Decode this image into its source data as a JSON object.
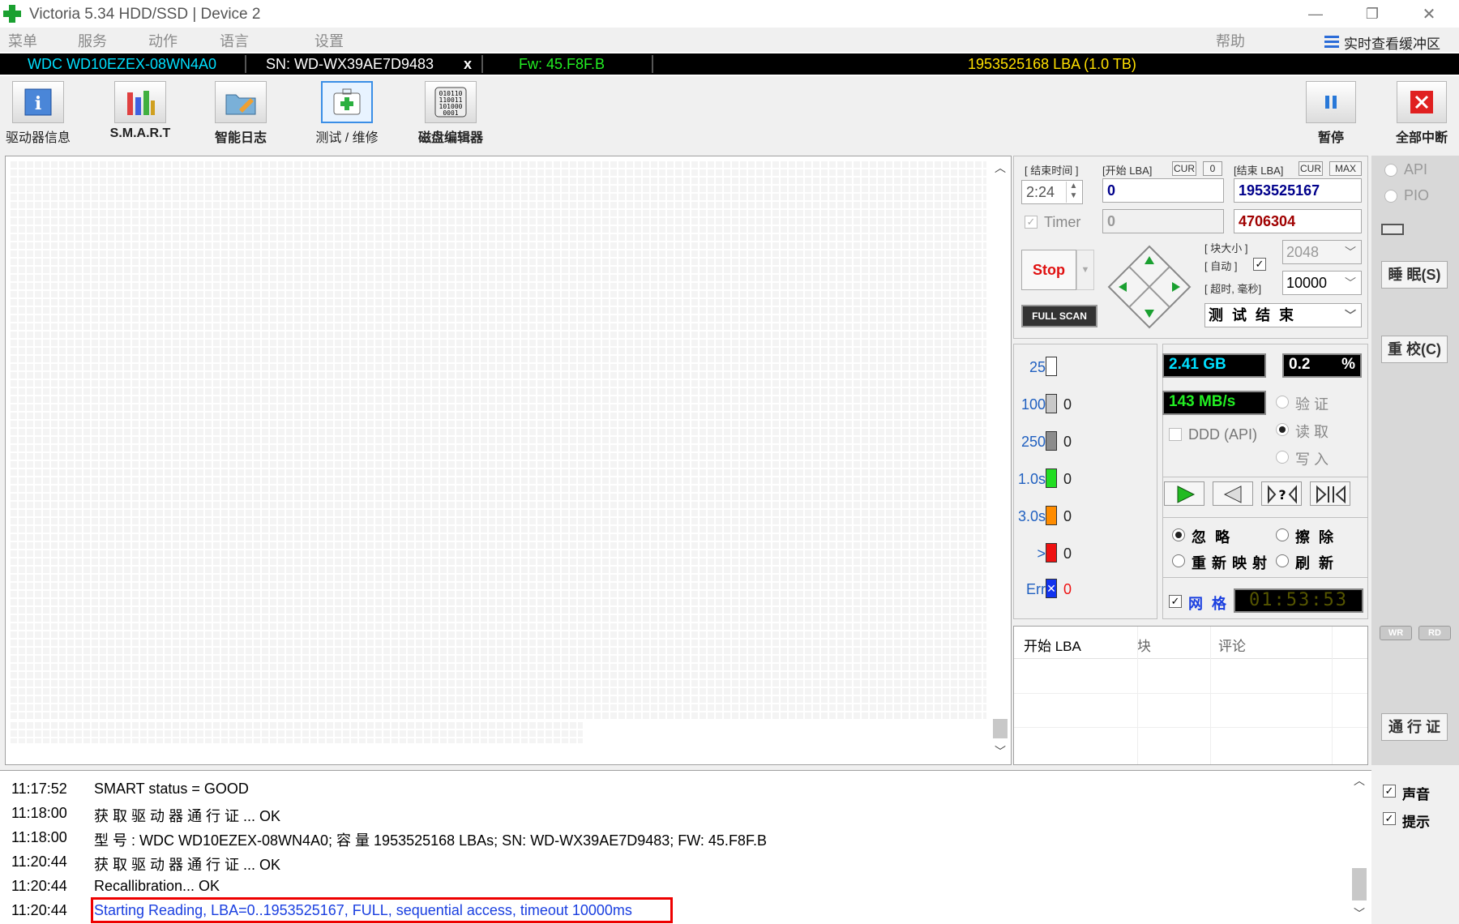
{
  "window": {
    "title": "Victoria 5.34 HDD/SSD | Device 2",
    "minimize": "—",
    "restore": "❐",
    "close": "✕"
  },
  "menu": {
    "items": [
      "菜单",
      "服务",
      "动作",
      "语言",
      "设置"
    ],
    "help": "帮助",
    "buffer": "实时查看缓冲区"
  },
  "drive": {
    "model": "WDC WD10EZEX-08WN4A0",
    "serial": "SN: WD-WX39AE7D9483",
    "close": "x",
    "firmware": "Fw: 45.F8F.B",
    "capacity": "1953525168 LBA (1.0 TB)"
  },
  "toolbar": {
    "drive_info": "驱动器信息",
    "smart": "S.M.A.R.T",
    "smart_log": "智能日志",
    "test_repair": "测试 / 维修",
    "disk_editor": "磁盘编辑器",
    "pause": "暂停",
    "abort_all": "全部中断"
  },
  "params": {
    "end_time_label": "[ 结束时间 ]",
    "start_lba_label": "[开始 LBA]",
    "end_lba_label": "[结束 LBA]",
    "cur": "CUR",
    "zero": "0",
    "max": "MAX",
    "time_value": "2:24",
    "start_lba": "0",
    "end_lba": "1953525167",
    "timer_label": "Timer",
    "timer_value": "0",
    "current_lba": "4706304",
    "stop": "Stop",
    "full_scan": "FULL SCAN",
    "block_size_label": "[ 块大小 ]",
    "auto_label": "[ 自动 ]",
    "block_size": "2048",
    "timeout_label": "[ 超时, 毫秒]",
    "timeout": "10000",
    "end_action": "测 试 结 束"
  },
  "histogram": [
    {
      "label": "25",
      "color": "#ffffff",
      "value": ""
    },
    {
      "label": "100",
      "color": "#c8c8c8",
      "value": "0"
    },
    {
      "label": "250",
      "color": "#8c8c8c",
      "value": "0"
    },
    {
      "label": "1.0s",
      "color": "#22dd22",
      "value": "0"
    },
    {
      "label": "3.0s",
      "color": "#ff8c00",
      "value": "0"
    },
    {
      "label": ">",
      "color": "#ee1111",
      "value": "0"
    },
    {
      "label": "Err",
      "color": "#1133ee",
      "value": "0"
    }
  ],
  "stats": {
    "read_amount": "2.41 GB",
    "percent": "0.2",
    "percent_sign": "%",
    "speed": "143 MB/s",
    "ddd_api": "DDD (API)",
    "verify": "验 证",
    "read": "读 取",
    "write": "写 入",
    "ignore": "忽 略",
    "erase": "擦 除",
    "remap": "重 新 映 射",
    "refresh": "刷 新",
    "grid": "网 格",
    "clock": "01:53:53"
  },
  "table": {
    "col_start": "开始 LBA",
    "col_block": "块",
    "col_comment": "评论"
  },
  "side": {
    "api": "API",
    "pio": "PIO",
    "sleep": "睡 眠(S)",
    "recalibrate": "重 校(C)",
    "wr": "WR",
    "rd": "RD",
    "passport": "通 行 证",
    "sound": "声音",
    "hints": "提示"
  },
  "log": [
    {
      "time": "11:17:52",
      "msg": "SMART status = GOOD"
    },
    {
      "time": "11:18:00",
      "msg": "获 取 驱 动 器 通 行 证 ... OK"
    },
    {
      "time": "11:18:00",
      "msg": "型 号 : WDC WD10EZEX-08WN4A0; 容 量  1953525168 LBAs; SN: WD-WX39AE7D9483; FW: 45.F8F.B"
    },
    {
      "time": "11:20:44",
      "msg": "获 取 驱 动 器 通 行 证 ... OK"
    },
    {
      "time": "11:20:44",
      "msg": "Recallibration... OK"
    },
    {
      "time": "11:20:44",
      "msg": "Starting Reading, LBA=0..1953525167, FULL, sequential access, timeout 10000ms"
    }
  ],
  "colors": {
    "drive_model": "#00e0ff",
    "firmware": "#22ee22",
    "capacity": "#ffe000",
    "lba_blue": "#00008b",
    "lba_red": "#a00000",
    "log_highlight": "#1a3fe0",
    "highlight_border": "#ee0000"
  }
}
